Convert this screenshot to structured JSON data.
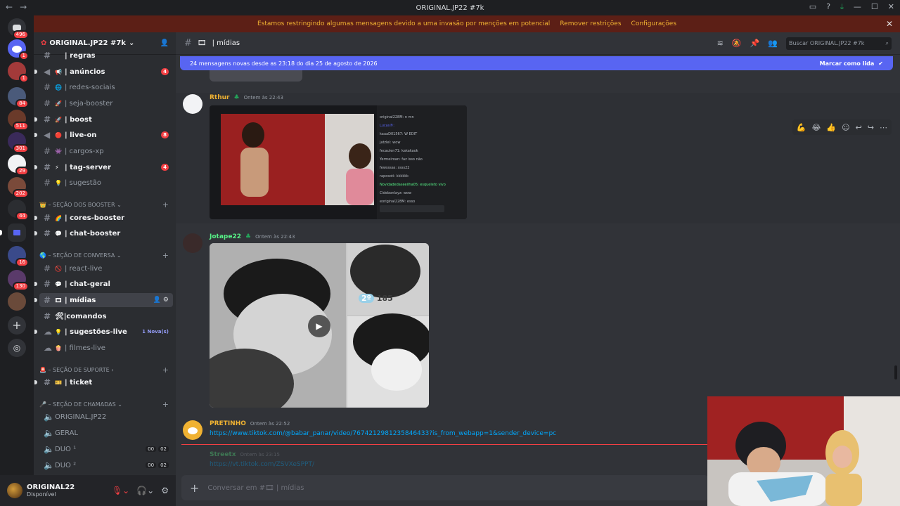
{
  "window": {
    "title": "ORIGINAL.JP22 #7k"
  },
  "banner": {
    "text": "Estamos restringindo algumas mensagens devido a uma invasão por menções em potencial",
    "remove": "Remover restrições",
    "settings": "Configurações"
  },
  "guild_badges": [
    "496",
    "1",
    "1",
    "84",
    "511",
    "301",
    "29",
    "202",
    "44",
    "16",
    "130"
  ],
  "server": {
    "name": "ORIGINAL.JP22 #7k"
  },
  "channels": [
    {
      "emoji": "",
      "name": "| regras",
      "bold": true
    },
    {
      "emoji": "📢",
      "name": "| anúncios",
      "bold": true,
      "badge": "4"
    },
    {
      "emoji": "🌐",
      "name": "| redes-sociais"
    },
    {
      "emoji": "🚀",
      "name": "| seja-booster"
    },
    {
      "emoji": "🚀",
      "name": "| boost",
      "bold": true
    },
    {
      "emoji": "🔴",
      "name": "| live-on",
      "bold": true,
      "badge": "8"
    },
    {
      "emoji": "👾",
      "name": "| cargos-xp"
    },
    {
      "emoji": "⚡",
      "name": "| tag-server",
      "bold": true,
      "badge": "4"
    },
    {
      "emoji": "💡",
      "name": "| sugestão"
    }
  ],
  "categories": {
    "booster": "SEÇÃO DOS BOOSTER",
    "conversa": "SEÇÃO DE CONVERSA",
    "suporte": "SEÇÃO DE SUPORTE",
    "chamadas": "SEÇÃO DE CHAMADAS"
  },
  "booster_channels": [
    {
      "emoji": "🌈",
      "name": "| cores-booster"
    },
    {
      "emoji": "💬",
      "name": "| chat-booster"
    }
  ],
  "conversa_channels": [
    {
      "emoji": "🚫",
      "name": "| react-live"
    },
    {
      "emoji": "💬",
      "name": "| chat-geral",
      "bold": true
    },
    {
      "emoji": "🎞",
      "name": "| mídias",
      "selected": true
    },
    {
      "emoji": "",
      "name": "🛠|comandos",
      "bold": true
    },
    {
      "emoji": "💡",
      "name": "| sugestões-live",
      "bold": true,
      "new": "1 Nova(s)"
    },
    {
      "emoji": "🍿",
      "name": "| filmes-live"
    }
  ],
  "suporte_channels": [
    {
      "emoji": "🎫",
      "name": "| ticket",
      "bold": true
    }
  ],
  "voice_channels": [
    {
      "name": "ORIGINAL.JP22"
    },
    {
      "name": "GERAL"
    },
    {
      "name": "DUO ¹",
      "count": "00",
      "limit": "02"
    },
    {
      "name": "DUO ²",
      "count": "00",
      "limit": "02"
    }
  ],
  "user": {
    "name": "ORIGINAL22",
    "status": "Disponível"
  },
  "channel_header": {
    "name": "| mídias",
    "search": "Buscar ORIGINAL.JP22 #7k"
  },
  "new_messages": {
    "text": "24 mensagens novas desde as 23:18 do dia 25 de agosto de 2026",
    "mark": "Marcar como lida"
  },
  "messages": [
    {
      "author": "Rthur",
      "time": "Ontem às 22:43",
      "color": "#f0b232"
    },
    {
      "author": "Jotape22",
      "time": "Ontem às 22:43",
      "color": "#57f287"
    },
    {
      "author": "PRETINHO",
      "time": "Ontem às 22:52",
      "color": "#f0b232",
      "link": "https://www.tiktok.com/@babar_panar/video/7674212981235846433?is_from_webapp=1&sender_device=pc"
    },
    {
      "author": "Streetx",
      "time": "Ontem às 23:15",
      "color": "#57f287",
      "link": "https://vt.tiktok.com/ZSVXeSPPT/"
    }
  ],
  "media_counter": {
    "rank": "2º",
    "value": "185"
  },
  "composer": {
    "placeholder": "Conversar em #🎞 | mídias"
  }
}
